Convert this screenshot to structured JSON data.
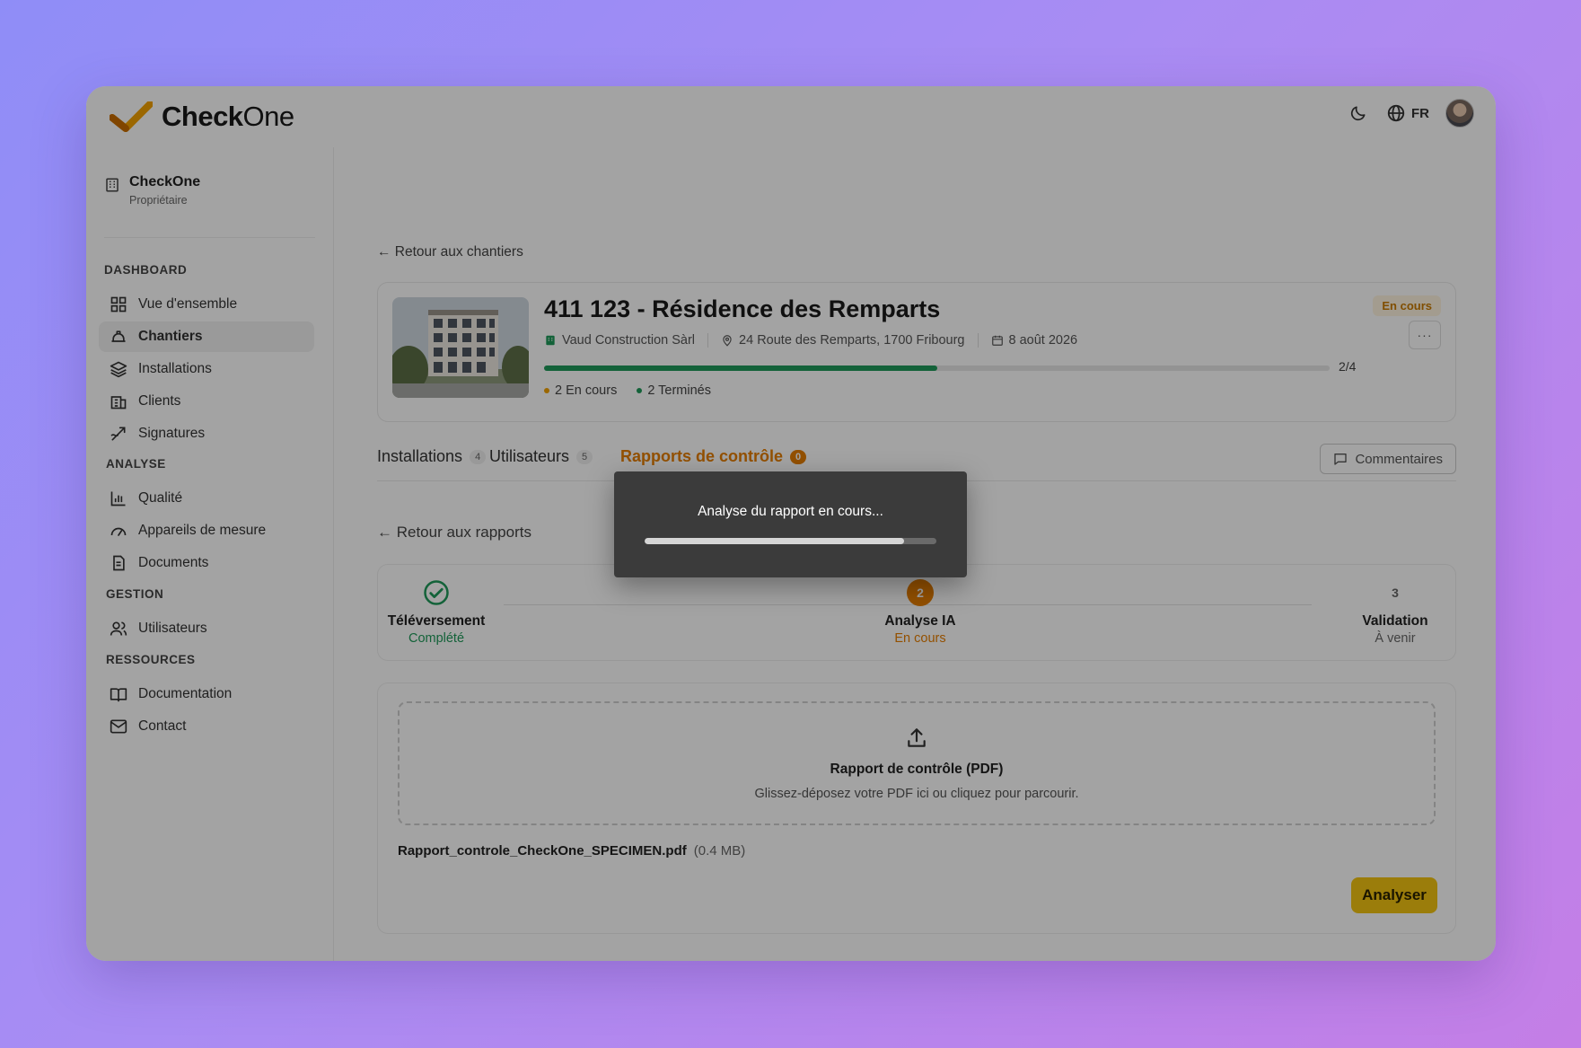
{
  "app": {
    "logo_text_bold": "Check",
    "logo_text_light": "One",
    "language": "FR"
  },
  "sidebar": {
    "org_name": "CheckOne",
    "org_role": "Propriétaire",
    "sections": {
      "dashboard": "DASHBOARD",
      "analyse": "ANALYSE",
      "gestion": "GESTION",
      "ressources": "RESSOURCES"
    },
    "items": [
      {
        "label": "Vue d'ensemble",
        "icon": "grid-icon"
      },
      {
        "label": "Chantiers",
        "icon": "hard-hat-icon",
        "active": true
      },
      {
        "label": "Installations",
        "icon": "layers-icon"
      },
      {
        "label": "Clients",
        "icon": "building-icon"
      },
      {
        "label": "Signatures",
        "icon": "signature-icon"
      },
      {
        "label": "Qualité",
        "icon": "bar-chart-icon"
      },
      {
        "label": "Appareils de mesure",
        "icon": "gauge-icon"
      },
      {
        "label": "Documents",
        "icon": "document-icon"
      },
      {
        "label": "Utilisateurs",
        "icon": "users-icon"
      },
      {
        "label": "Documentation",
        "icon": "book-icon"
      },
      {
        "label": "Contact",
        "icon": "mail-icon"
      }
    ]
  },
  "main": {
    "back_to_sites": "← Retour aux chantiers",
    "project": {
      "title": "411 123 - Résidence des Remparts",
      "company": "Vaud Construction Sàrl",
      "address": "24 Route des Remparts, 1700 Fribourg",
      "date": "8 août 2026",
      "status": "En cours",
      "progress_text": "2/4",
      "progress_fraction": 0.5,
      "in_progress": "2 En cours",
      "done": "2 Terminés",
      "more": "···"
    },
    "tabs": [
      {
        "label": "Installations",
        "count": "4"
      },
      {
        "label": "Utilisateurs",
        "count": "5"
      },
      {
        "label": "Rapports de contrôle",
        "count": "0",
        "active": true
      }
    ],
    "comments_label": "Commentaires",
    "back_to_reports": "← Retour aux rapports",
    "steps": [
      {
        "name": "Téléversement",
        "state": "Complété"
      },
      {
        "number": "2",
        "name": "Analyse IA",
        "state": "En cours"
      },
      {
        "number": "3",
        "name": "Validation",
        "state": "À venir"
      }
    ],
    "upload": {
      "title": "Rapport de contrôle (PDF)",
      "subtitle": "Glissez-déposez votre PDF ici ou cliquez pour parcourir.",
      "file_name": "Rapport_controle_CheckOne_SPECIMEN.pdf",
      "file_size": "(0.4 MB)",
      "analyse_button": "Analyser"
    }
  },
  "modal": {
    "text": "Analyse du rapport en cours...",
    "progress_fraction": 0.89
  },
  "colors": {
    "accent": "#e67e00",
    "success": "#1f9a59",
    "primary_button": "#f2c412"
  }
}
